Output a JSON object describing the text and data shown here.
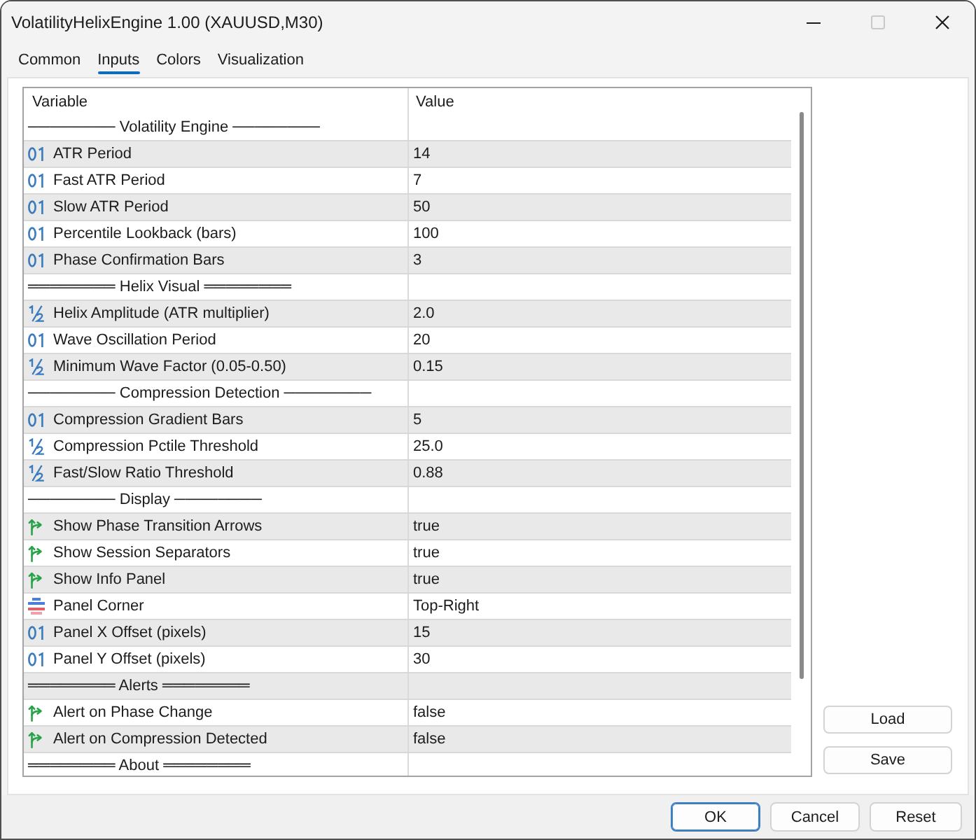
{
  "window": {
    "title": "VolatilityHelixEngine 1.00 (XAUUSD,M30)",
    "controls": [
      {
        "kind": "minimize",
        "disabled": false
      },
      {
        "kind": "maximize",
        "disabled": true
      },
      {
        "kind": "close",
        "disabled": false
      }
    ]
  },
  "tabs": [
    {
      "label": "Common",
      "selected": false
    },
    {
      "label": "Inputs",
      "selected": true
    },
    {
      "label": "Colors",
      "selected": false
    },
    {
      "label": "Visualization",
      "selected": false
    }
  ],
  "table": {
    "columns": [
      "Variable",
      "Value"
    ],
    "rows": [
      {
        "kind": "separator",
        "label": "──────── Volatility Engine ────────"
      },
      {
        "kind": "int",
        "variable": "ATR Period",
        "value": "14"
      },
      {
        "kind": "int",
        "variable": "Fast ATR Period",
        "value": "7"
      },
      {
        "kind": "int",
        "variable": "Slow ATR Period",
        "value": "50"
      },
      {
        "kind": "int",
        "variable": "Percentile Lookback (bars)",
        "value": "100"
      },
      {
        "kind": "int",
        "variable": "Phase Confirmation Bars",
        "value": "3"
      },
      {
        "kind": "separator",
        "label": "════════ Helix Visual ════════"
      },
      {
        "kind": "double",
        "variable": "Helix Amplitude (ATR multiplier)",
        "value": "2.0"
      },
      {
        "kind": "int",
        "variable": "Wave Oscillation Period",
        "value": "20"
      },
      {
        "kind": "double",
        "variable": "Minimum Wave Factor (0.05-0.50)",
        "value": "0.15"
      },
      {
        "kind": "separator",
        "label": "──────── Compression Detection ────────"
      },
      {
        "kind": "int",
        "variable": "Compression Gradient Bars",
        "value": "5"
      },
      {
        "kind": "double",
        "variable": "Compression Pctile Threshold",
        "value": "25.0"
      },
      {
        "kind": "double",
        "variable": "Fast/Slow Ratio Threshold",
        "value": "0.88"
      },
      {
        "kind": "separator",
        "label": "──────── Display ────────"
      },
      {
        "kind": "bool",
        "variable": "Show Phase Transition Arrows",
        "value": "true"
      },
      {
        "kind": "bool",
        "variable": "Show Session Separators",
        "value": "true"
      },
      {
        "kind": "bool",
        "variable": "Show Info Panel",
        "value": "true"
      },
      {
        "kind": "enum",
        "variable": "Panel Corner",
        "value": "Top-Right"
      },
      {
        "kind": "int",
        "variable": "Panel X Offset (pixels)",
        "value": "15"
      },
      {
        "kind": "int",
        "variable": "Panel Y Offset (pixels)",
        "value": "30"
      },
      {
        "kind": "separator",
        "label": "════════ Alerts ════════"
      },
      {
        "kind": "bool",
        "variable": "Alert on Phase Change",
        "value": "false"
      },
      {
        "kind": "bool",
        "variable": "Alert on Compression Detected",
        "value": "false"
      },
      {
        "kind": "separator",
        "label": "════════ About ════════"
      }
    ]
  },
  "side_buttons": [
    "Load",
    "Save"
  ],
  "buttons": [
    {
      "label": "OK",
      "default": true
    },
    {
      "label": "Cancel",
      "default": false
    },
    {
      "label": "Reset",
      "default": false
    }
  ]
}
